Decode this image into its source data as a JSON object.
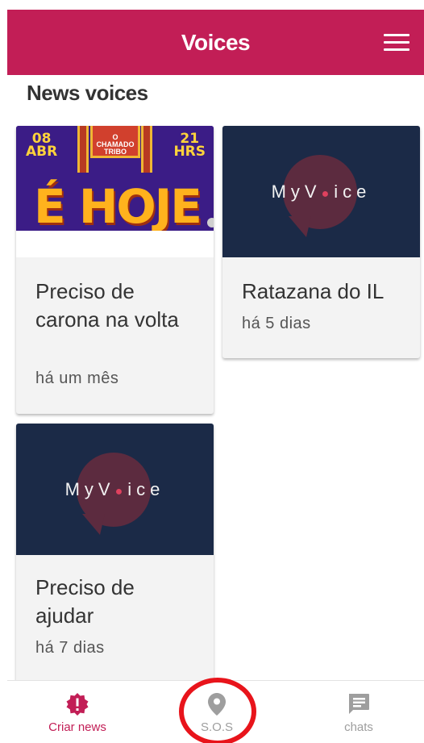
{
  "app": {
    "title": "Voices"
  },
  "section": {
    "title": "News voices"
  },
  "cards": [
    {
      "title": "Preciso de carona na volta",
      "time": "há um mês",
      "poster": {
        "date_left": "08\nABR",
        "date_right": "21\nHRS",
        "sign": "O CHAMADO\nTRIBO",
        "headline": "É HOJE"
      }
    },
    {
      "title": "Ratazana do IL",
      "time": "há 5 dias",
      "logo": {
        "pre": "MyV",
        "o": "●",
        "post": "ice"
      }
    },
    {
      "title": "Preciso de ajudar",
      "time": "há 7 dias",
      "logo": {
        "pre": "MyV",
        "o": "●",
        "post": "ice"
      }
    }
  ],
  "bottom_nav": [
    {
      "label": "Criar news",
      "icon": "alert-badge-icon",
      "active": true
    },
    {
      "label": "S.O.S",
      "icon": "location-pin-icon",
      "active": false
    },
    {
      "label": "chats",
      "icon": "chat-icon",
      "active": false
    }
  ],
  "colors": {
    "primary": "#c21e56",
    "media_bg": "#1b2a47",
    "highlight_ring": "#e8141b"
  }
}
